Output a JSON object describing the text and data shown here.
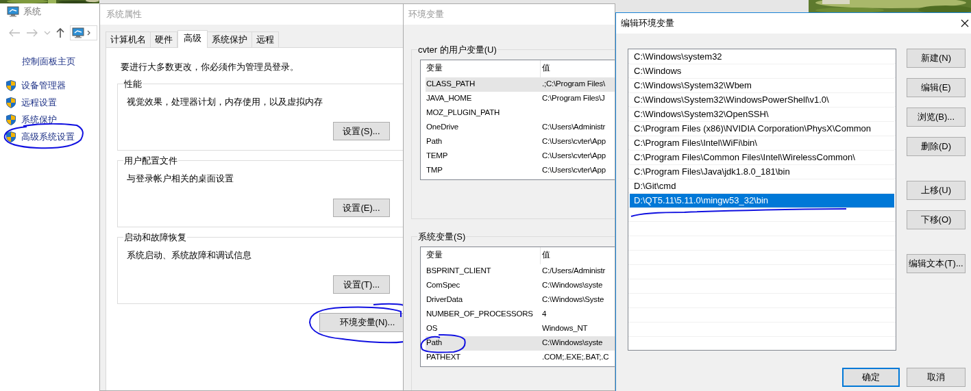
{
  "control_panel": {
    "title": "系统",
    "home_link": "控制面板主页",
    "links": [
      {
        "label": "设备管理器",
        "annotated": false
      },
      {
        "label": "远程设置",
        "annotated": false
      },
      {
        "label": "系统保护",
        "annotated": false
      },
      {
        "label": "高级系统设置",
        "annotated": true
      }
    ]
  },
  "system_properties": {
    "title": "系统属性",
    "tabs": [
      {
        "label": "计算机名",
        "selected": false
      },
      {
        "label": "硬件",
        "selected": false
      },
      {
        "label": "高级",
        "selected": true
      },
      {
        "label": "系统保护",
        "selected": false
      },
      {
        "label": "远程",
        "selected": false
      }
    ],
    "notice": "要进行大多数更改，你必须作为管理员登录。",
    "groups": [
      {
        "title": "性能",
        "description": "视觉效果，处理器计划，内存使用，以及虚拟内存",
        "button": "设置(S)..."
      },
      {
        "title": "用户配置文件",
        "description": "与登录帐户相关的桌面设置",
        "button": "设置(E)..."
      },
      {
        "title": "启动和故障恢复",
        "description": "系统启动、系统故障和调试信息",
        "button": "设置(T)..."
      }
    ],
    "env_button": {
      "label": "环境变量(N)...",
      "annotated": true
    }
  },
  "environment_variables": {
    "title": "环境变量",
    "sections": [
      {
        "title": "cvter 的用户变量(U)",
        "columns": [
          "变量",
          "值"
        ],
        "rows": [
          {
            "name": "CLASS_PATH",
            "value": ".;C:\\Program Files\\",
            "selected": true,
            "annotated": false
          },
          {
            "name": "JAVA_HOME",
            "value": "C:\\Program Files\\J",
            "selected": false,
            "annotated": false
          },
          {
            "name": "MOZ_PLUGIN_PATH",
            "selected": false,
            "annotated": false
          },
          {
            "name": "OneDrive",
            "value": "C:\\Users\\Administr",
            "selected": false,
            "annotated": false
          },
          {
            "name": "Path",
            "value": "C:\\Users\\cvter\\App",
            "selected": false,
            "annotated": false
          },
          {
            "name": "TEMP",
            "value": "C:\\Users\\cvter\\App",
            "selected": false,
            "annotated": false
          },
          {
            "name": "TMP",
            "value": "C:\\Users\\cvter\\App",
            "selected": false,
            "annotated": false
          }
        ]
      },
      {
        "title": "系统变量(S)",
        "columns": [
          "变量",
          "值"
        ],
        "rows": [
          {
            "name": "BSPRINT_CLIENT",
            "value": "C:/Users/Administr",
            "selected": false,
            "annotated": false
          },
          {
            "name": "ComSpec",
            "value": "C:\\Windows\\syste",
            "selected": false,
            "annotated": false
          },
          {
            "name": "DriverData",
            "value": "C:\\Windows\\Syste",
            "selected": false,
            "annotated": false
          },
          {
            "name": "NUMBER_OF_PROCESSORS",
            "value": "4",
            "selected": false,
            "annotated": false
          },
          {
            "name": "OS",
            "value": "Windows_NT",
            "selected": false,
            "annotated": false
          },
          {
            "name": "Path",
            "value": "C:\\Windows\\syste",
            "selected": true,
            "annotated": true
          },
          {
            "name": "PATHEXT",
            "value": ".COM;.EXE;.BAT;.C",
            "selected": false,
            "annotated": false
          }
        ]
      }
    ]
  },
  "edit_dialog": {
    "title": "编辑环境变量",
    "entries": [
      {
        "text": "C:\\Windows\\system32",
        "selected": false,
        "annotated": false
      },
      {
        "text": "C:\\Windows",
        "selected": false,
        "annotated": false
      },
      {
        "text": "C:\\Windows\\System32\\Wbem",
        "selected": false,
        "annotated": false
      },
      {
        "text": "C:\\Windows\\System32\\WindowsPowerShell\\v1.0\\",
        "selected": false,
        "annotated": false
      },
      {
        "text": "C:\\Windows\\System32\\OpenSSH\\",
        "selected": false,
        "annotated": false
      },
      {
        "text": "C:\\Program Files (x86)\\NVIDIA Corporation\\PhysX\\Common",
        "selected": false,
        "annotated": false
      },
      {
        "text": "C:\\Program Files\\Intel\\WiFi\\bin\\",
        "selected": false,
        "annotated": false
      },
      {
        "text": "C:\\Program Files\\Common Files\\Intel\\WirelessCommon\\",
        "selected": false,
        "annotated": false
      },
      {
        "text": "C:\\Program Files\\Java\\jdk1.8.0_181\\bin",
        "selected": false,
        "annotated": false
      },
      {
        "text": "D:\\Git\\cmd",
        "selected": false,
        "annotated": false
      },
      {
        "text": "D:\\QT5.11\\5.11.0\\mingw53_32\\bin",
        "selected": true,
        "annotated": true
      }
    ],
    "side_button_groups": [
      [
        "新建(N)",
        "编辑(E)",
        "浏览(B)...",
        "删除(D)"
      ],
      [
        "上移(U)",
        "下移(O)"
      ],
      [
        "编辑文本(T)..."
      ]
    ],
    "ok_button": "确定",
    "cancel_button": "取消"
  }
}
